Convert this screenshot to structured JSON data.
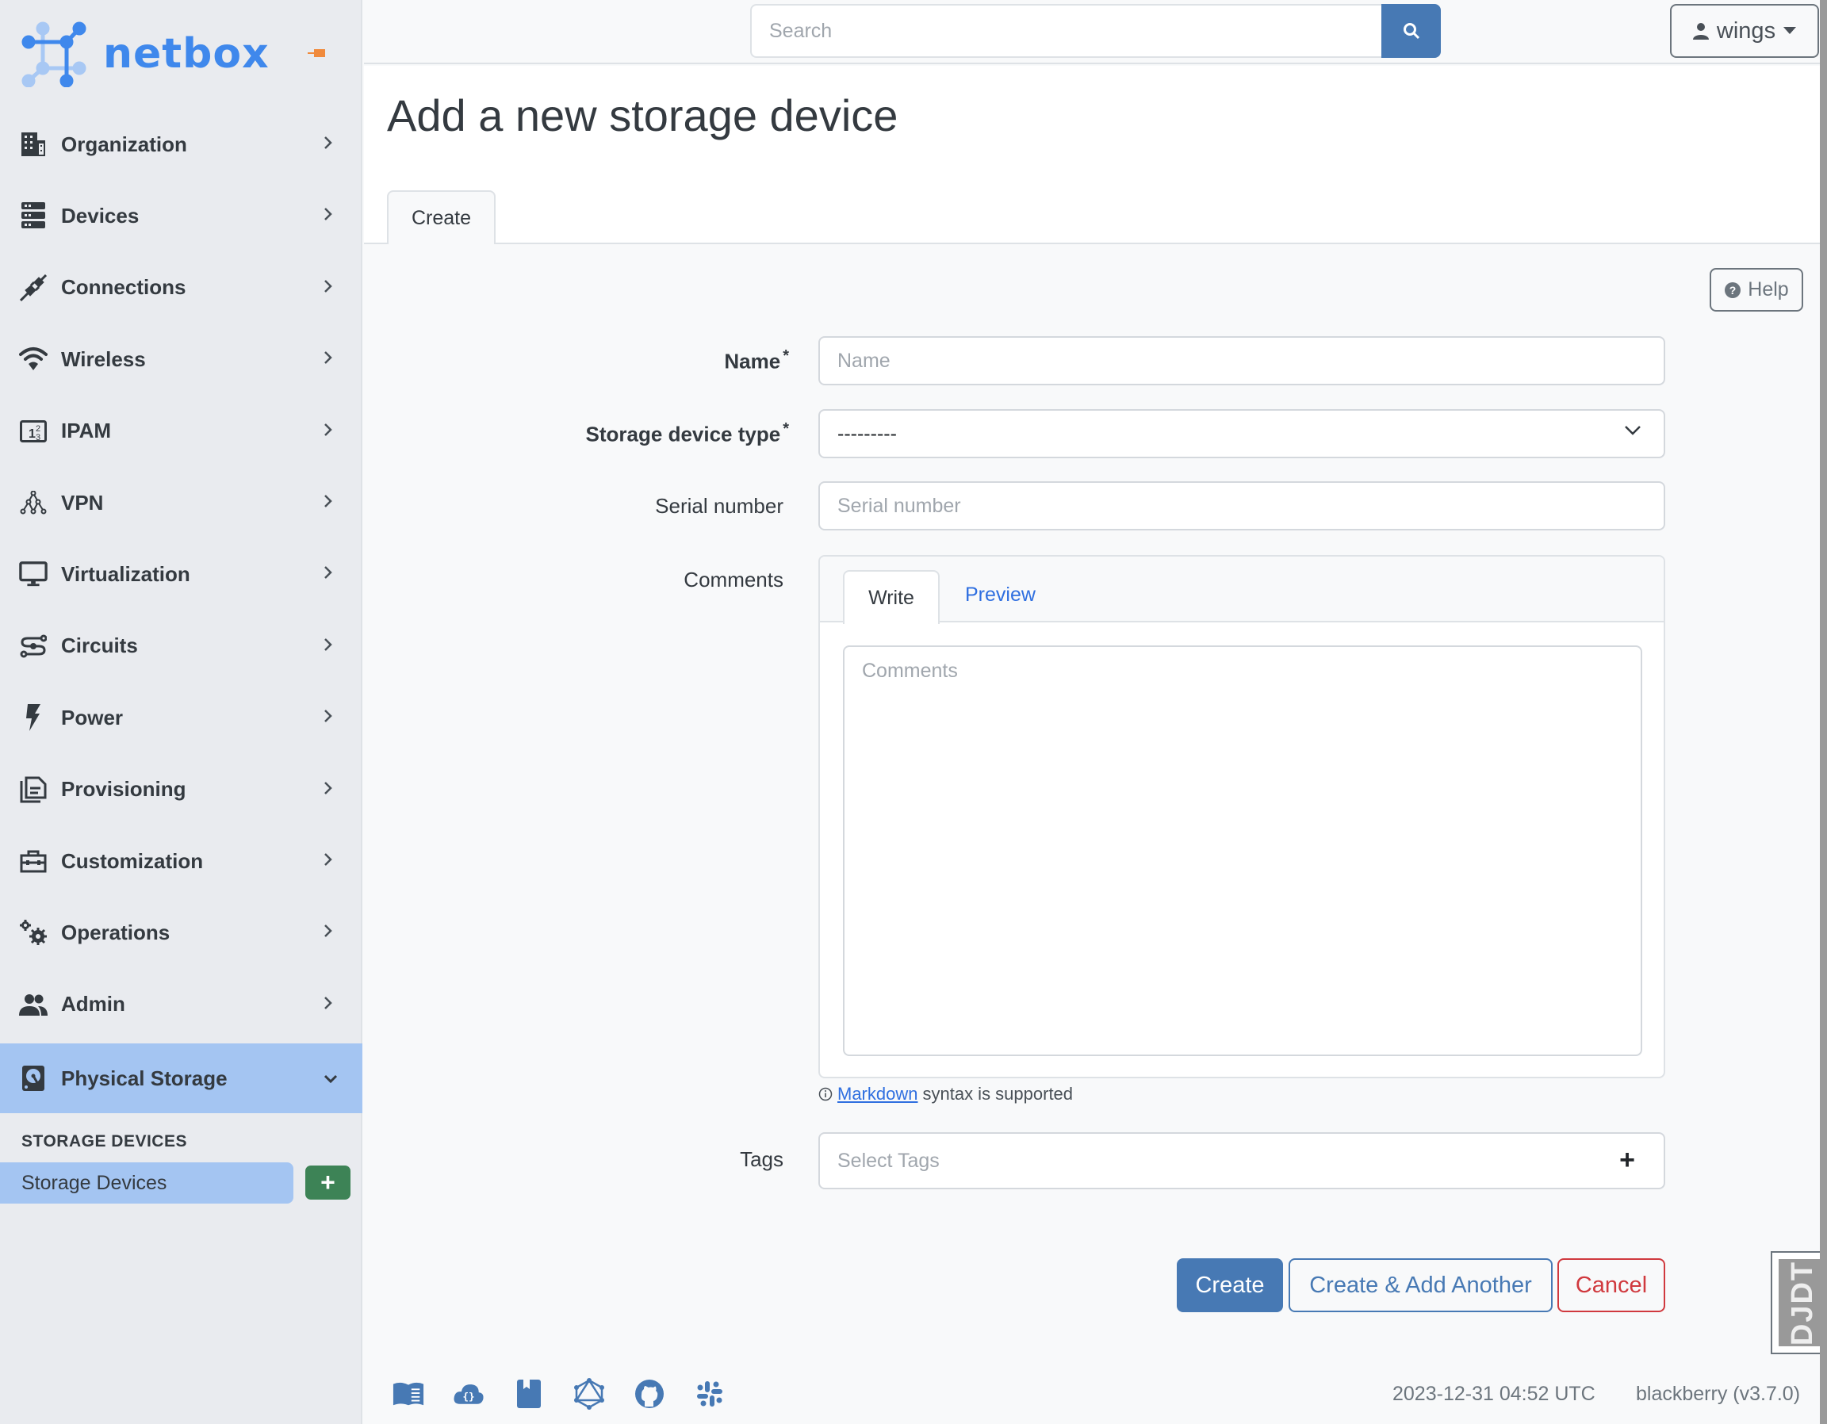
{
  "app": {
    "brand": "netbox"
  },
  "sidebar": {
    "items": [
      {
        "label": "Organization",
        "icon": "building-icon"
      },
      {
        "label": "Devices",
        "icon": "server-icon"
      },
      {
        "label": "Connections",
        "icon": "plug-icon"
      },
      {
        "label": "Wireless",
        "icon": "wifi-icon"
      },
      {
        "label": "IPAM",
        "icon": "counter-icon"
      },
      {
        "label": "VPN",
        "icon": "graph-icon"
      },
      {
        "label": "Virtualization",
        "icon": "monitor-icon"
      },
      {
        "label": "Circuits",
        "icon": "transit-icon"
      },
      {
        "label": "Power",
        "icon": "flash-icon"
      },
      {
        "label": "Provisioning",
        "icon": "file-document-icon"
      },
      {
        "label": "Customization",
        "icon": "toolbox-icon"
      },
      {
        "label": "Operations",
        "icon": "cogs-icon"
      },
      {
        "label": "Admin",
        "icon": "account-group-icon"
      }
    ],
    "active_item": {
      "label": "Physical Storage",
      "icon": "harddisk-icon"
    },
    "section_title": "STORAGE DEVICES",
    "sub_item": "Storage Devices",
    "add_button": "+"
  },
  "topbar": {
    "search_placeholder": "Search",
    "user": "wings"
  },
  "page": {
    "title": "Add a new storage device",
    "tab": "Create",
    "help": "Help"
  },
  "form": {
    "name": {
      "label": "Name",
      "required": "*",
      "placeholder": "Name"
    },
    "type": {
      "label": "Storage device type",
      "required": "*",
      "value": "---------"
    },
    "serial": {
      "label": "Serial number",
      "placeholder": "Serial number"
    },
    "comments": {
      "label": "Comments",
      "tab_write": "Write",
      "tab_preview": "Preview",
      "placeholder": "Comments"
    },
    "helper": {
      "link": "Markdown",
      "text": "syntax is supported"
    },
    "tags": {
      "label": "Tags",
      "placeholder": "Select Tags",
      "add": "+"
    }
  },
  "actions": {
    "create": "Create",
    "create_another": "Create & Add Another",
    "cancel": "Cancel"
  },
  "debug_toolbar": "DJDT",
  "footer": {
    "icons": [
      "book-open-icon",
      "cloud-braces-icon",
      "bookmark-icon",
      "graphql-icon",
      "github-icon",
      "slack-icon"
    ],
    "timestamp": "2023-12-31 04:52 UTC",
    "hostname": "blackberry (v3.7.0)"
  },
  "colors": {
    "brand": "#3f88ec",
    "primary": "#4779b4",
    "danger": "#d0393e",
    "success": "#3d8356",
    "active": "#a4c5f2"
  }
}
